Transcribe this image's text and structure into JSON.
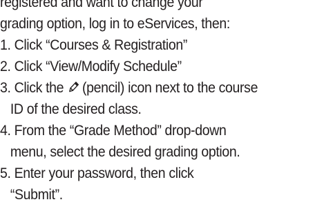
{
  "intro": {
    "line1": "If you have already registered and want to change your",
    "line1a": "registered and want to change your",
    "line2": "grading option, log in to eServices, then:"
  },
  "steps": [
    {
      "num": "1.",
      "text": "Click “Courses & Registration”"
    },
    {
      "num": "2.",
      "text": "Click “View/Modify Schedule”"
    },
    {
      "num": "3.",
      "text_before_icon": "Click the ",
      "icon": "pencil-icon",
      "text_after_icon": " (pencil) icon next to the course",
      "text_cont": "ID of the desired class."
    },
    {
      "num": "4.",
      "text": "From the “Grade Method” drop-down",
      "text_cont": "menu, select the desired grading option."
    },
    {
      "num": "5.",
      "text": "Enter your password, then click",
      "text_cont": "“Submit”."
    }
  ]
}
